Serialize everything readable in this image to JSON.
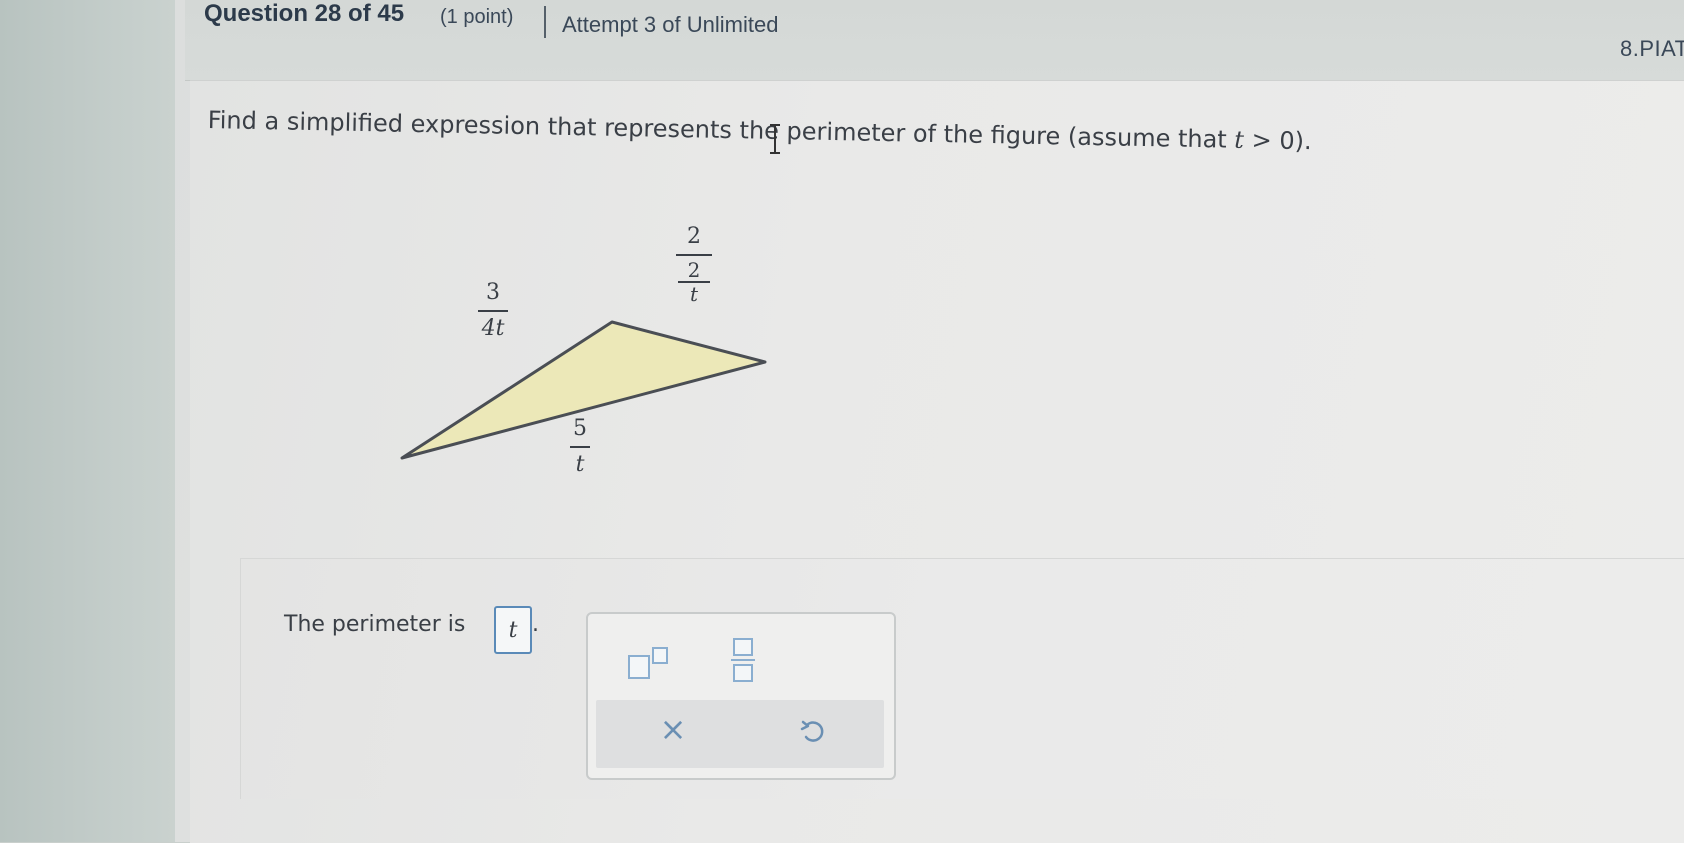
{
  "header": {
    "question_number": "Question 28 of 45",
    "points": "(1 point)",
    "attempt": "Attempt 3 of Unlimited",
    "code": "8.PIAT"
  },
  "prompt": {
    "text_before": "Find a simplified expression that represents the perimeter of the figure (assume that ",
    "variable": "t",
    "condition": " > 0)."
  },
  "figure": {
    "fill_color": "#ece8b8",
    "stroke_color": "#4a4e54",
    "label_left": {
      "num": "3",
      "den": "4t"
    },
    "label_right": {
      "num": "2",
      "den_num": "2",
      "den_den": "t"
    },
    "label_bottom": {
      "num": "5",
      "den": "t"
    }
  },
  "answer": {
    "label": "The perimeter is",
    "input_value": "t",
    "trailing": "."
  },
  "palette": {
    "power_button": "exponent-template",
    "fraction_button": "fraction-template",
    "clear_symbol": "×",
    "undo_icon": "undo-icon",
    "accent_color": "#7da0c4"
  }
}
